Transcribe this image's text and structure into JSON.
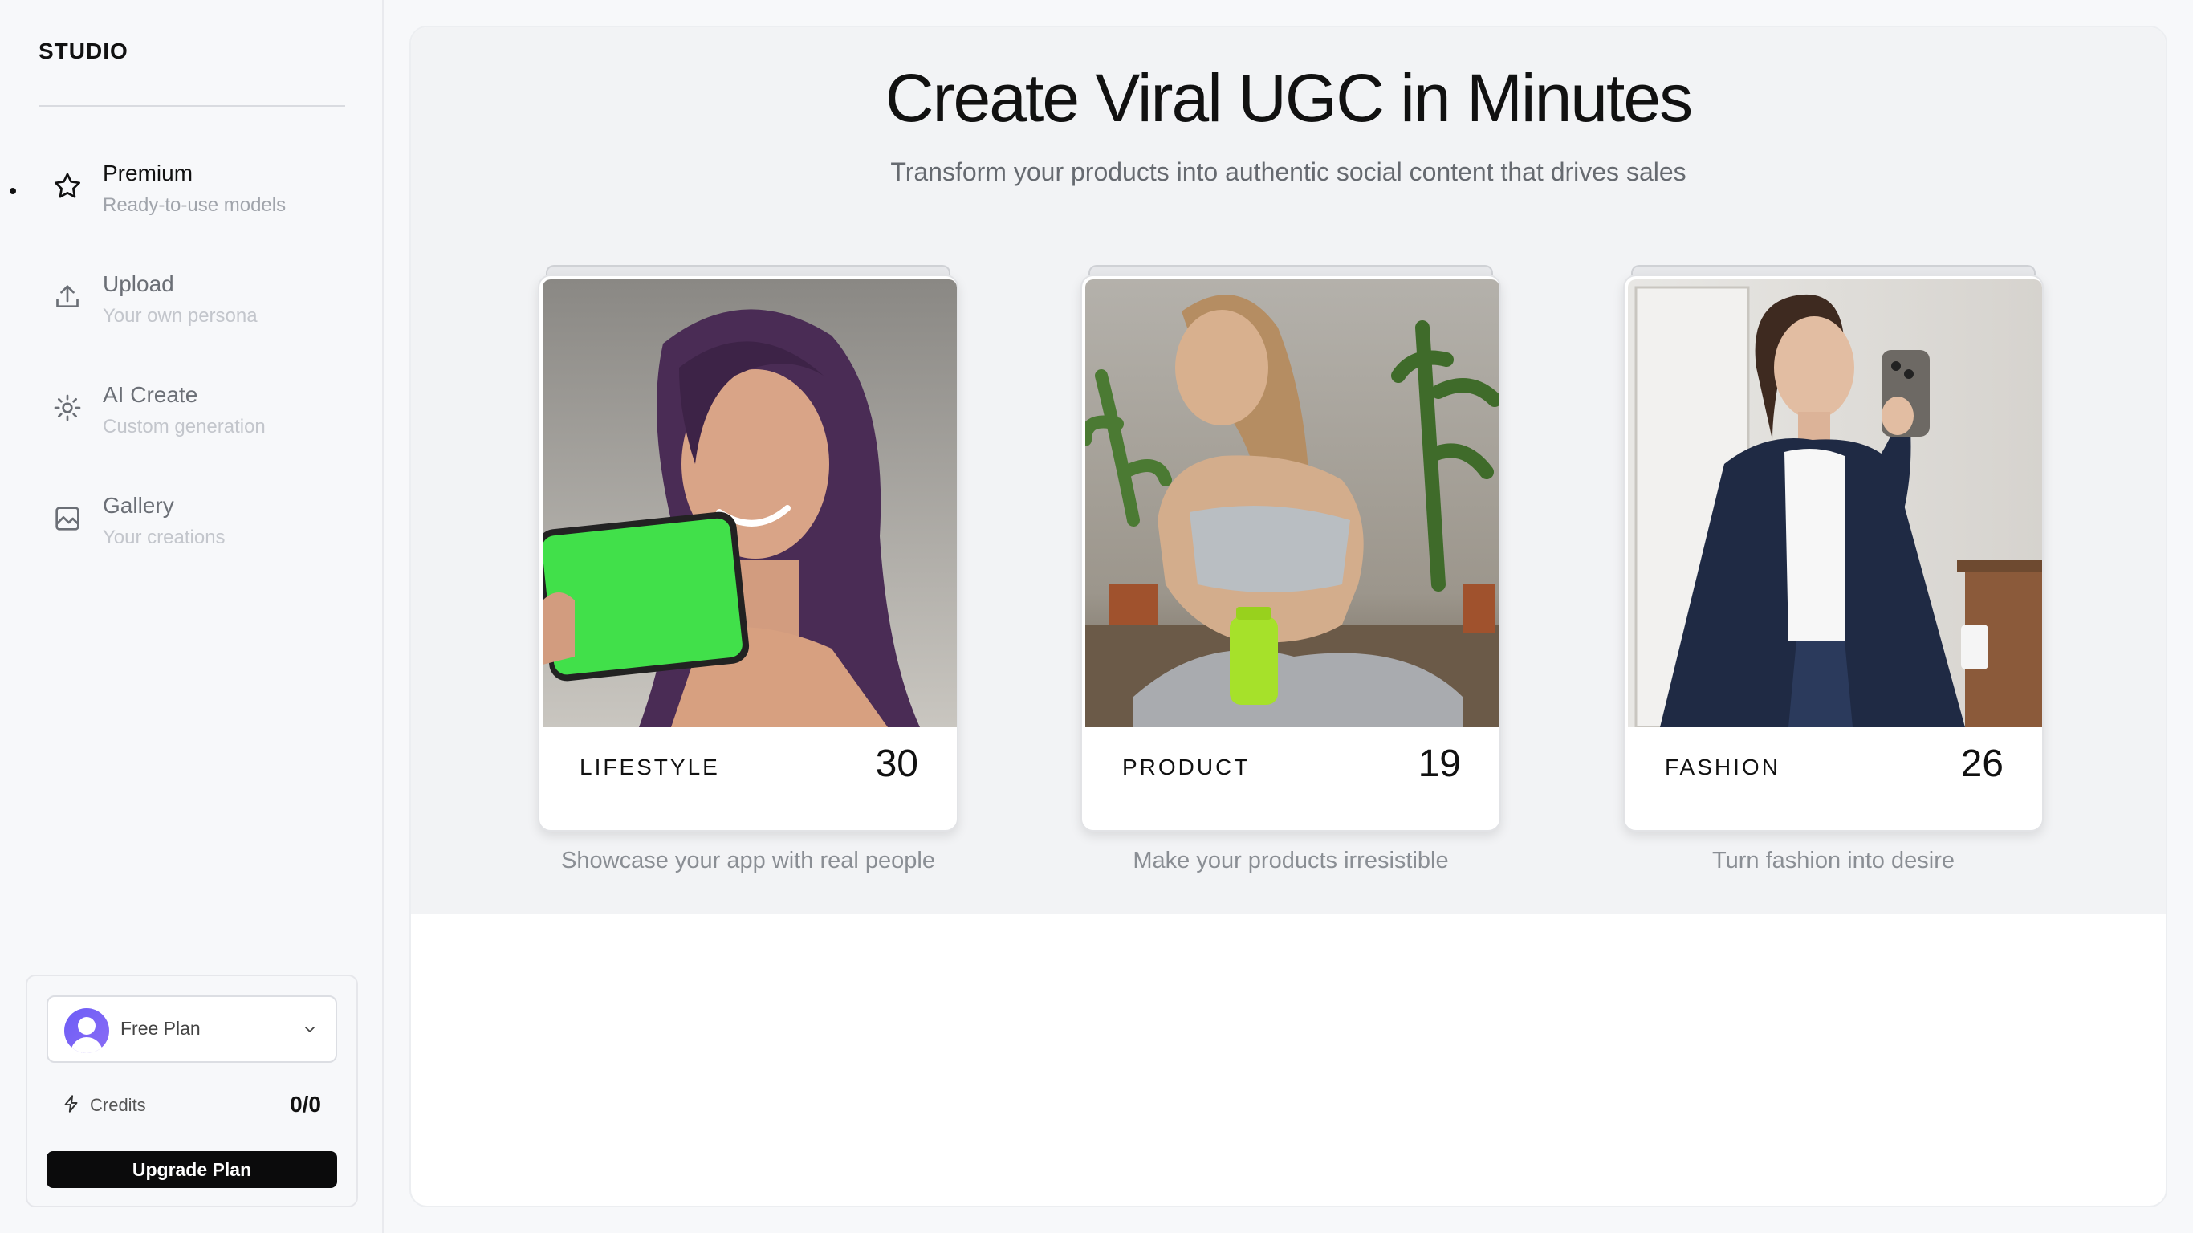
{
  "sidebar": {
    "brand": "STUDIO",
    "items": [
      {
        "label": "Premium",
        "sub": "Ready-to-use models",
        "icon": "star-icon"
      },
      {
        "label": "Upload",
        "sub": "Your own persona",
        "icon": "upload-icon"
      },
      {
        "label": "AI Create",
        "sub": "Custom generation",
        "icon": "sparkle-icon"
      },
      {
        "label": "Gallery",
        "sub": "Your creations",
        "icon": "image-icon"
      }
    ],
    "plan": {
      "name": "Free Plan",
      "credits_label": "Credits",
      "credits_value": "0/0",
      "upgrade_label": "Upgrade Plan"
    }
  },
  "main": {
    "title": "Create Viral UGC in Minutes",
    "subtitle": "Transform your products into authentic social content that drives sales",
    "cards": [
      {
        "category": "LIFESTYLE",
        "count": "30",
        "caption": "Showcase your app with real people"
      },
      {
        "category": "PRODUCT",
        "count": "19",
        "caption": "Make your products irresistible"
      },
      {
        "category": "FASHION",
        "count": "26",
        "caption": "Turn fashion into desire"
      }
    ]
  }
}
